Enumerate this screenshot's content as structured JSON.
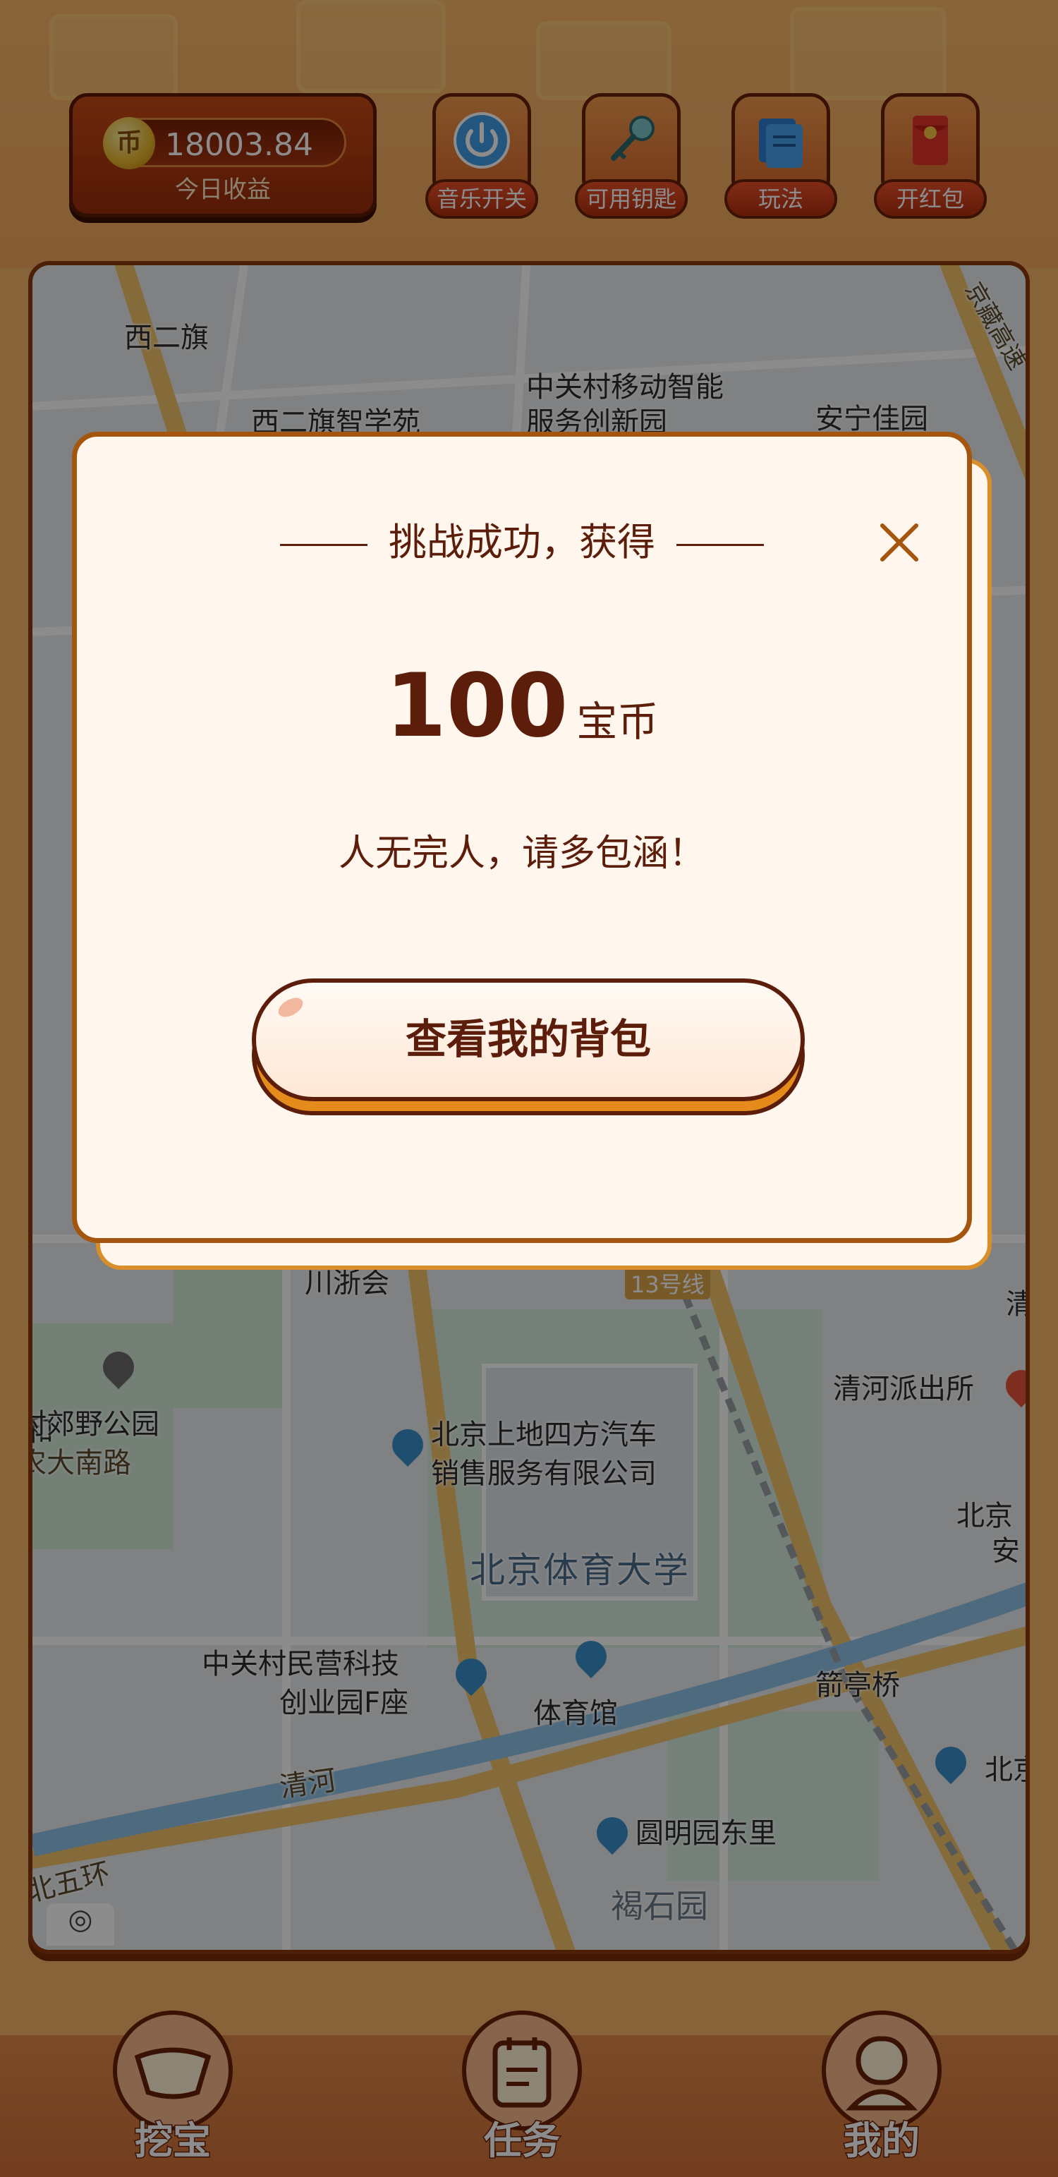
{
  "header": {
    "coin_symbol": "币",
    "coin_balance": "18003.84",
    "coin_caption": "今日收益",
    "tools": [
      {
        "label": "音乐开关",
        "icon": "power-icon"
      },
      {
        "label": "可用钥匙",
        "icon": "key-icon"
      },
      {
        "label": "玩法",
        "icon": "book-icon"
      },
      {
        "label": "开红包",
        "icon": "red-envelope-icon"
      }
    ]
  },
  "map": {
    "labels": {
      "xierqi": "西二旗",
      "xierqi_zhixueyuan": "西二旗智学苑",
      "zgc_mobile": "中关村移动智能",
      "zgc_mobile_2": "服务创新园",
      "anning": "安宁佳园",
      "jingzang": "京藏高速",
      "chuanzhe": "川浙会",
      "line13": "13号线",
      "qinghe_police": "清河派出所",
      "park": "村郊野公园",
      "nanlu": "农大南路",
      "auto": "北京上地四方汽车",
      "auto_2": "销售服务有限公司",
      "sport_univ": "北京体育大学",
      "zgc_private": "中关村民营科技",
      "zgc_private_2": "创业园F座",
      "gym": "体育馆",
      "jianting": "箭亭桥",
      "qinghe": "清河",
      "wuhuan": "北五环",
      "yuanming": "圆明园东里",
      "heshiyuan": "褐石园",
      "he": "和",
      "beijing_r": "北京",
      "an": "安",
      "qing": "清",
      "beike": "北京科"
    }
  },
  "modal": {
    "title": "挑战成功，获得",
    "reward_amount": "100",
    "reward_unit": "宝币",
    "message": "人无完人，请多包涵！",
    "action_label": "查看我的背包"
  },
  "bottom_nav": [
    {
      "label": "挖宝",
      "icon": "gold-ingot-icon"
    },
    {
      "label": "任务",
      "icon": "task-clipboard-icon"
    },
    {
      "label": "我的",
      "icon": "user-icon"
    }
  ],
  "colors": {
    "accent_brown": "#5c1e0a",
    "modal_border": "#a4560e",
    "button_shadow": "#e48b1c",
    "overlay": "rgba(0,0,0,0.45)"
  }
}
